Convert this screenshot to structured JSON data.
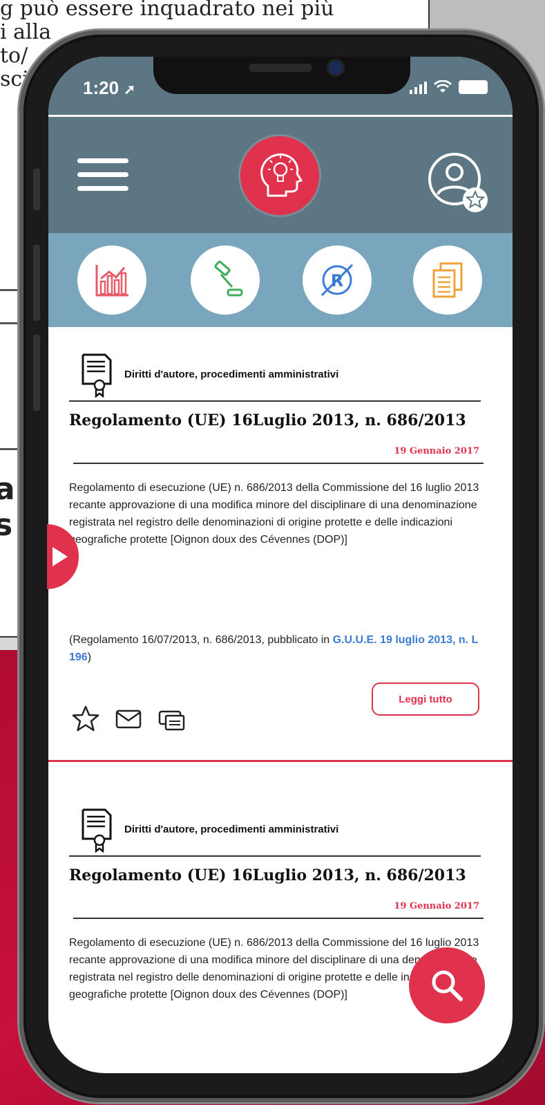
{
  "background_doc": {
    "lines": [
      "g può essere inquadrato nei più",
      "i alla",
      "to/",
      "sci"
    ],
    "heading": [
      "ar",
      "s"
    ]
  },
  "status_bar": {
    "time": "1:20"
  },
  "header": {
    "menu_icon": "hamburger-icon",
    "logo_icon": "lightbulb-head-icon",
    "profile_icon": "user-star-icon"
  },
  "categories": [
    {
      "icon": "chart-icon",
      "color": "#e85a66"
    },
    {
      "icon": "gavel-icon",
      "color": "#3fae5a"
    },
    {
      "icon": "registered-trademark-icon",
      "color": "#3a7bd5"
    },
    {
      "icon": "documents-icon",
      "color": "#f0a23a"
    }
  ],
  "articles": [
    {
      "topic": "Diritti d'autore, procedimenti amministrativi",
      "title": "Regolamento (UE) 16Luglio 2013, n. 686/2013",
      "date": "19 Gennaio 2017",
      "body": "Regolamento di esecuzione (UE) n. 686/2013 della Commissione del 16 luglio 2013 recante approvazione di una modifica minore del disciplinare di una denominazione registrata nel registro delle denominazioni di origine protette e delle indicazioni geografiche protette [Oignon doux des Cévennes (DOP)]",
      "ref_prefix": "(Regolamento 16/07/2013, n. 686/2013, pubblicato in ",
      "ref_link": "G.U.U.E. 19 luglio 2013, n. L 196",
      "ref_suffix": ")",
      "read_more": "Leggi tutto"
    },
    {
      "topic": "Diritti d'autore, procedimenti amministrativi",
      "title": "Regolamento (UE) 16Luglio 2013, n. 686/2013",
      "date": "19 Gennaio 2017",
      "body": "Regolamento di esecuzione (UE) n. 686/2013 della Commissione del 16 luglio 2013 recante approvazione di una modifica minore del disciplinare di una denominazione registrata nel registro delle denominazioni di origine protette e delle indicazioni geografiche protette [Oignon doux des Cévennes (DOP)]"
    }
  ],
  "fab_icon": "search-icon",
  "colors": {
    "header": "#5d7683",
    "category_bar": "#7aa6bd",
    "accent": "#e0324d",
    "link": "#3a7bd5"
  }
}
